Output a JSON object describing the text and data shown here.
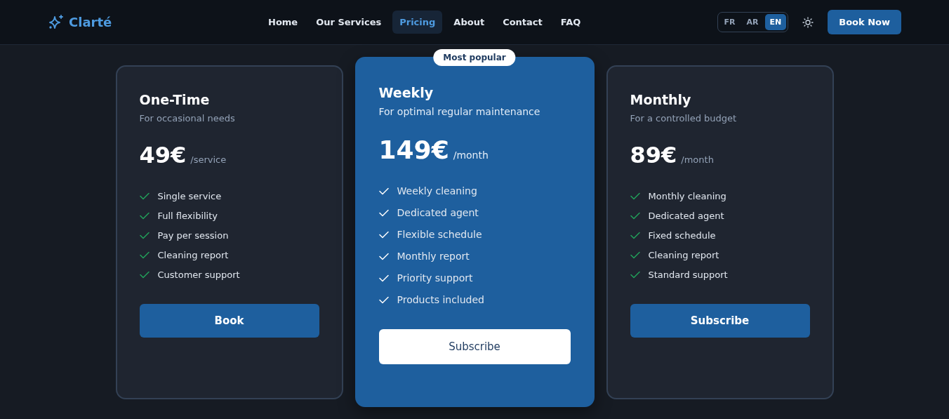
{
  "header": {
    "logo": "Clarté",
    "nav": [
      {
        "label": "Home",
        "selected": false
      },
      {
        "label": "Our Services",
        "selected": false
      },
      {
        "label": "Pricing",
        "selected": true
      },
      {
        "label": "About",
        "selected": false
      },
      {
        "label": "Contact",
        "selected": false
      },
      {
        "label": "FAQ",
        "selected": false
      }
    ],
    "languages": [
      {
        "label": "FR",
        "selected": false
      },
      {
        "label": "AR",
        "selected": false
      },
      {
        "label": "EN",
        "selected": true
      }
    ],
    "cta": "Book Now"
  },
  "plans": [
    {
      "name": "One-Time",
      "subtitle": "For occasional needs",
      "price": "49€",
      "period": "/service",
      "featured": false,
      "features": [
        "Single service",
        "Full flexibility",
        "Pay per session",
        "Cleaning report",
        "Customer support"
      ],
      "button": "Book"
    },
    {
      "name": "Weekly",
      "subtitle": "For optimal regular maintenance",
      "price": "149€",
      "period": "/month",
      "featured": true,
      "badge": "Most popular",
      "features": [
        "Weekly cleaning",
        "Dedicated agent",
        "Flexible schedule",
        "Monthly report",
        "Priority support",
        "Products included"
      ],
      "button": "Subscribe"
    },
    {
      "name": "Monthly",
      "subtitle": "For a controlled budget",
      "price": "89€",
      "period": "/month",
      "featured": false,
      "features": [
        "Monthly cleaning",
        "Dedicated agent",
        "Fixed schedule",
        "Cleaning report",
        "Standard support"
      ],
      "button": "Subscribe"
    }
  ]
}
